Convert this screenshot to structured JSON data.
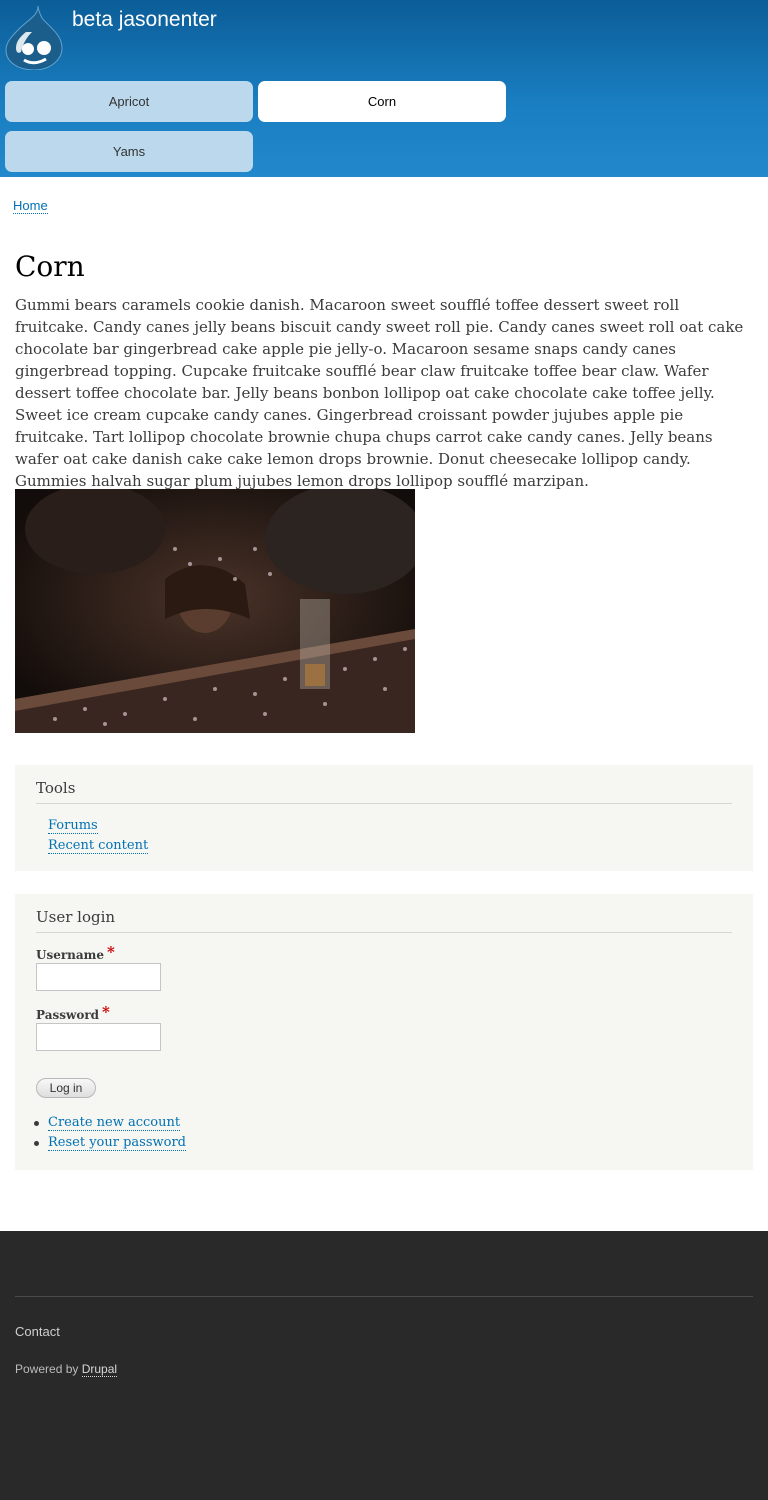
{
  "header": {
    "site_name": "beta jasonenter",
    "menu": [
      {
        "label": "Apricot",
        "active": false
      },
      {
        "label": "Corn",
        "active": true
      },
      {
        "label": "Yams",
        "active": false
      }
    ],
    "gradient_top": "#0b5d97",
    "gradient_bottom": "#2388cc"
  },
  "breadcrumb": {
    "home": "Home"
  },
  "content": {
    "title": "Corn",
    "body": "Gummi bears caramels cookie danish. Macaroon sweet soufflé toffee dessert sweet roll fruitcake. Candy canes jelly beans biscuit candy sweet roll pie. Candy canes sweet roll oat cake chocolate bar gingerbread cake apple pie jelly-o. Macaroon sesame snaps candy canes gingerbread topping. Cupcake fruitcake soufflé bear claw fruitcake toffee bear claw. Wafer dessert toffee chocolate bar. Jelly beans bonbon lollipop oat cake chocolate cake toffee jelly. Sweet ice cream cupcake candy canes. Gingerbread croissant powder jujubes apple pie fruitcake. Tart lollipop chocolate brownie chupa chups carrot cake candy canes. Jelly beans wafer oat cake danish cake cake lemon drops brownie. Donut cheesecake lollipop candy. Gummies halvah sugar plum jujubes lemon drops lollipop soufflé marzipan."
  },
  "tools": {
    "title": "Tools",
    "links": [
      "Forums",
      "Recent content"
    ]
  },
  "login": {
    "title": "User login",
    "username_label": "Username",
    "password_label": "Password",
    "required_mark": "*",
    "button": "Log in",
    "links": [
      "Create new account",
      "Reset your password"
    ]
  },
  "footer": {
    "contact": "Contact",
    "powered_by": "Powered by",
    "drupal_link": "Drupal"
  },
  "colors": {
    "link": "#0071b3",
    "footer_bg": "#292929",
    "block_bg": "#f6f6f2"
  },
  "icons": {
    "logo": "drupal-drop-logo-icon"
  }
}
